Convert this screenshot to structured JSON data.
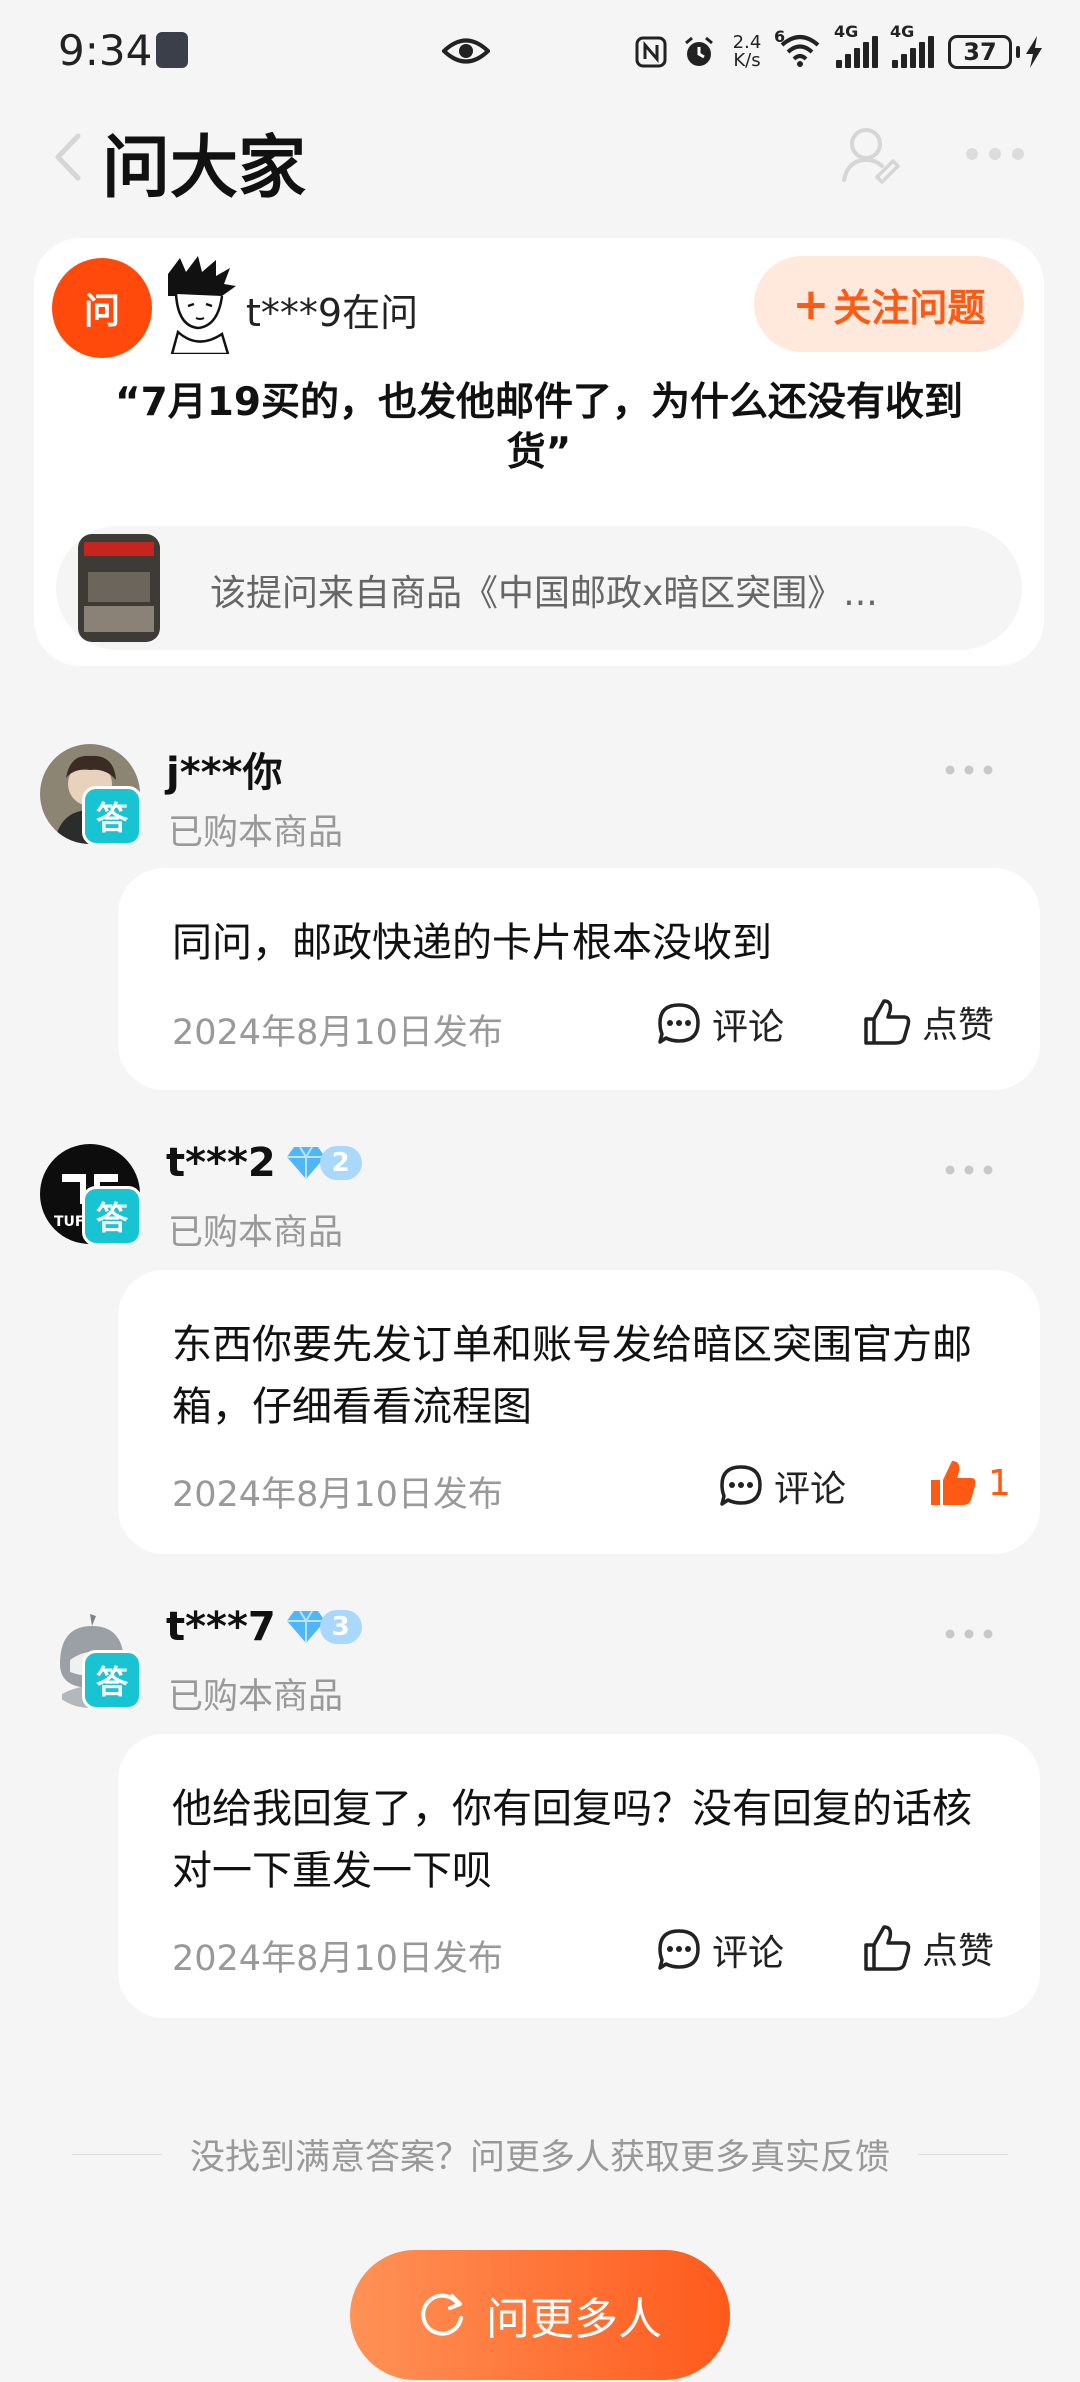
{
  "status_bar": {
    "time": "9:34",
    "net_speed_top": "2.4",
    "net_speed_bottom": "K/s",
    "wifi_label": "6",
    "signal1_label": "4G",
    "signal2_label": "4G",
    "battery": "37"
  },
  "header": {
    "title": "问大家"
  },
  "question": {
    "ask_badge": "问",
    "asker": "t***9在问",
    "follow_label": "关注问题",
    "text": "“7月19买的，也发他邮件了，为什么还没有收到货”",
    "product_text": "该提问来自商品《中国邮政x暗区突围》..."
  },
  "answers": [
    {
      "badge": "答",
      "name": "j***你",
      "level": "",
      "meta": "已购本商品",
      "text": "同问，邮政快递的卡片根本没收到",
      "date": "2024年8月10日发布",
      "comment_label": "评论",
      "like_label": "点赞",
      "liked": false
    },
    {
      "badge": "答",
      "name": "t***2",
      "level": "2",
      "meta": "已购本商品",
      "text": "东西你要先发订单和账号发给暗区突围官方邮箱，仔细看看流程图",
      "date": "2024年8月10日发布",
      "comment_label": "评论",
      "like_label": "1",
      "liked": true
    },
    {
      "badge": "答",
      "name": "t***7",
      "level": "3",
      "meta": "已购本商品",
      "text": "他给我回复了，你有回复吗？没有回复的话核对一下重发一下呗",
      "date": "2024年8月10日发布",
      "comment_label": "评论",
      "like_label": "点赞",
      "liked": false
    }
  ],
  "footer": {
    "note": "没找到满意答案？问更多人获取更多真实反馈",
    "ask_more_label": "问更多人"
  },
  "colors": {
    "accent": "#ff5a14",
    "answer_badge": "#19c4d2",
    "page_bg": "#f5f5f5"
  }
}
